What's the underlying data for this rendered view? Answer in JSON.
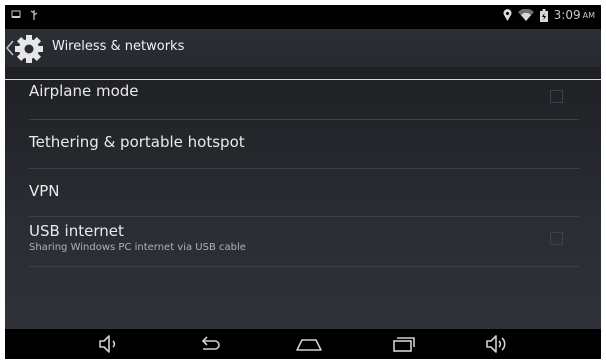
{
  "status_bar": {
    "time": "3:09",
    "ampm": "AM",
    "icons": [
      "notification-icon",
      "usb-icon",
      "location-icon",
      "wifi-icon",
      "battery-icon"
    ]
  },
  "action_bar": {
    "title": "Wireless & networks",
    "icons": [
      "back-chevron-icon",
      "settings-gear-icon"
    ]
  },
  "settings": {
    "items": [
      {
        "title": "Airplane mode",
        "has_checkbox": true
      },
      {
        "title": "Tethering & portable hotspot"
      },
      {
        "title": "VPN"
      },
      {
        "title": "USB internet",
        "summary": "Sharing Windows PC internet via USB cable",
        "has_checkbox": true
      }
    ]
  },
  "nav_bar": {
    "buttons": [
      "volume-down-icon",
      "back-icon",
      "home-icon",
      "recents-icon",
      "volume-up-icon"
    ]
  },
  "colors": {
    "background": "#2a2d33",
    "text": "#eaeaea",
    "secondary_text": "#b0b0b0"
  }
}
